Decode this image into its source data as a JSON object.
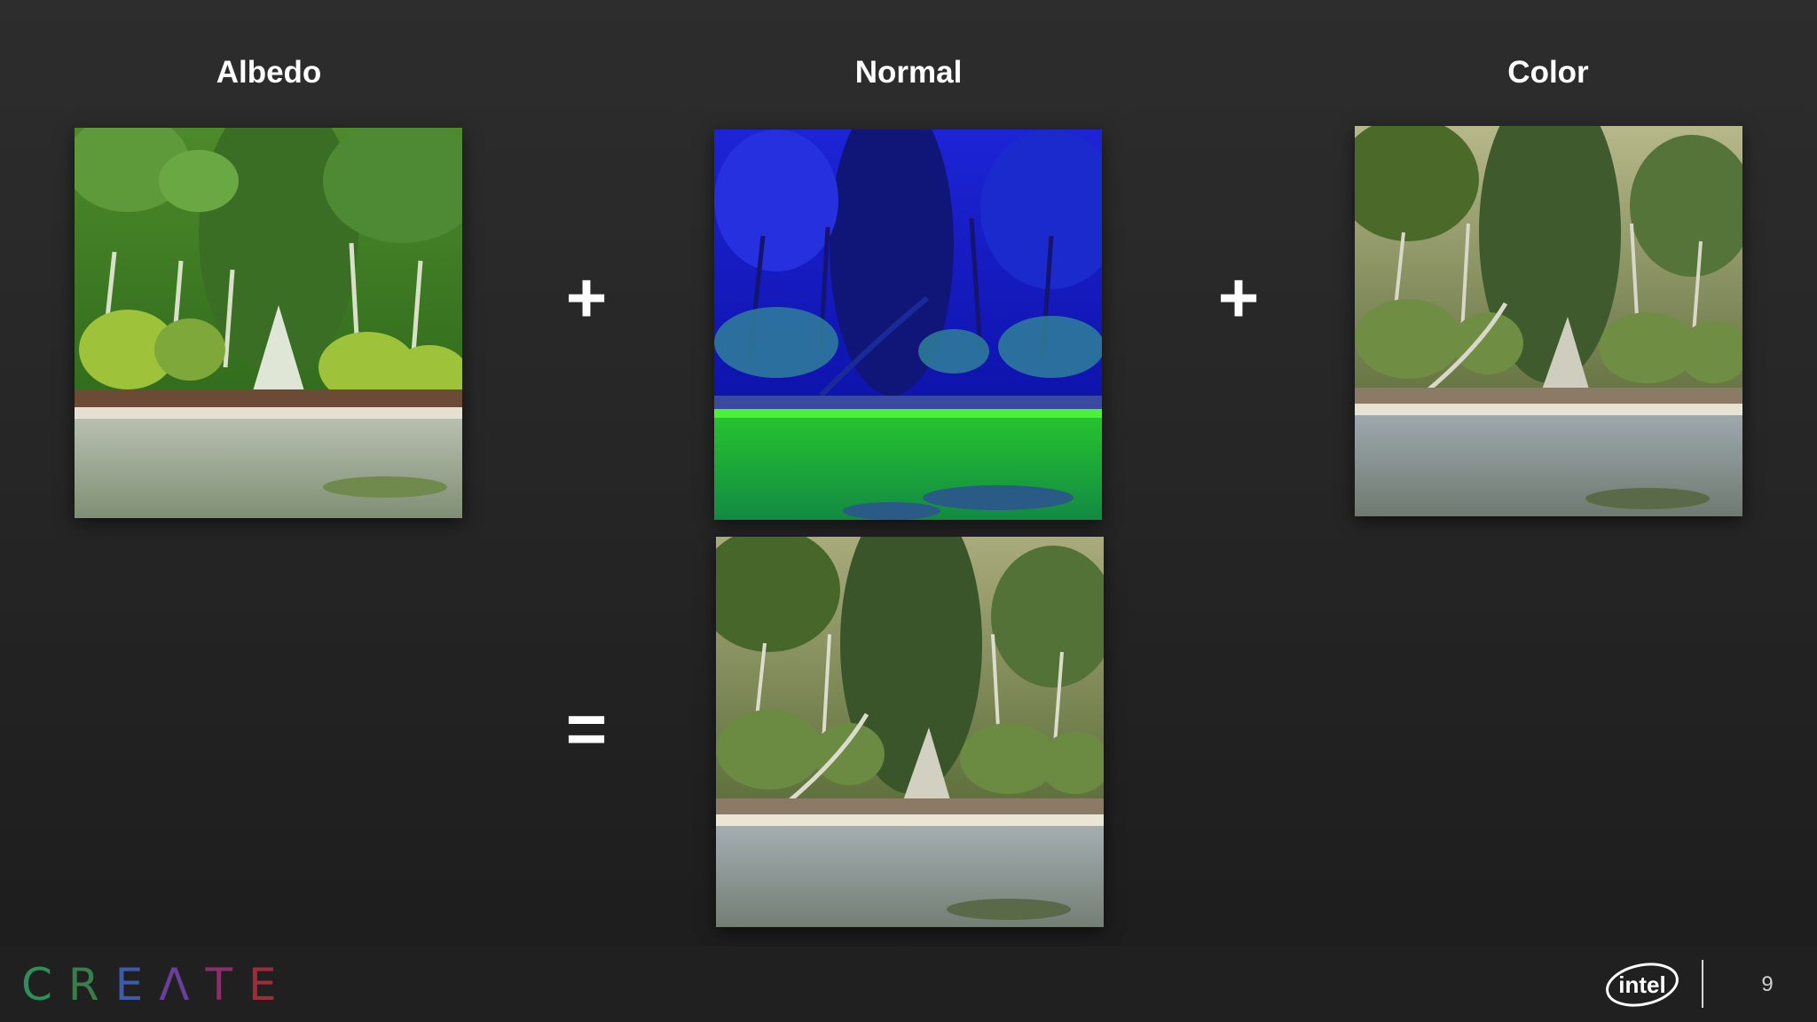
{
  "slide": {
    "labels": {
      "albedo": "Albedo",
      "normal": "Normal",
      "color": "Color"
    },
    "operators": {
      "plus_1": "+",
      "plus_2": "+",
      "equals": "="
    },
    "page_number": "9"
  },
  "footer": {
    "brand_letters": [
      "C",
      "R",
      "E",
      "Λ",
      "T",
      "E"
    ],
    "brand_letter_colors": [
      "#2f8f5b",
      "#3a7d4a",
      "#3f5aa8",
      "#6a3f9a",
      "#8a2f6a",
      "#a02b3a"
    ],
    "company_logo": "intel",
    "company_logo_icon": "intel-logo"
  },
  "colors": {
    "background": "#262626",
    "text": "#ffffff"
  }
}
